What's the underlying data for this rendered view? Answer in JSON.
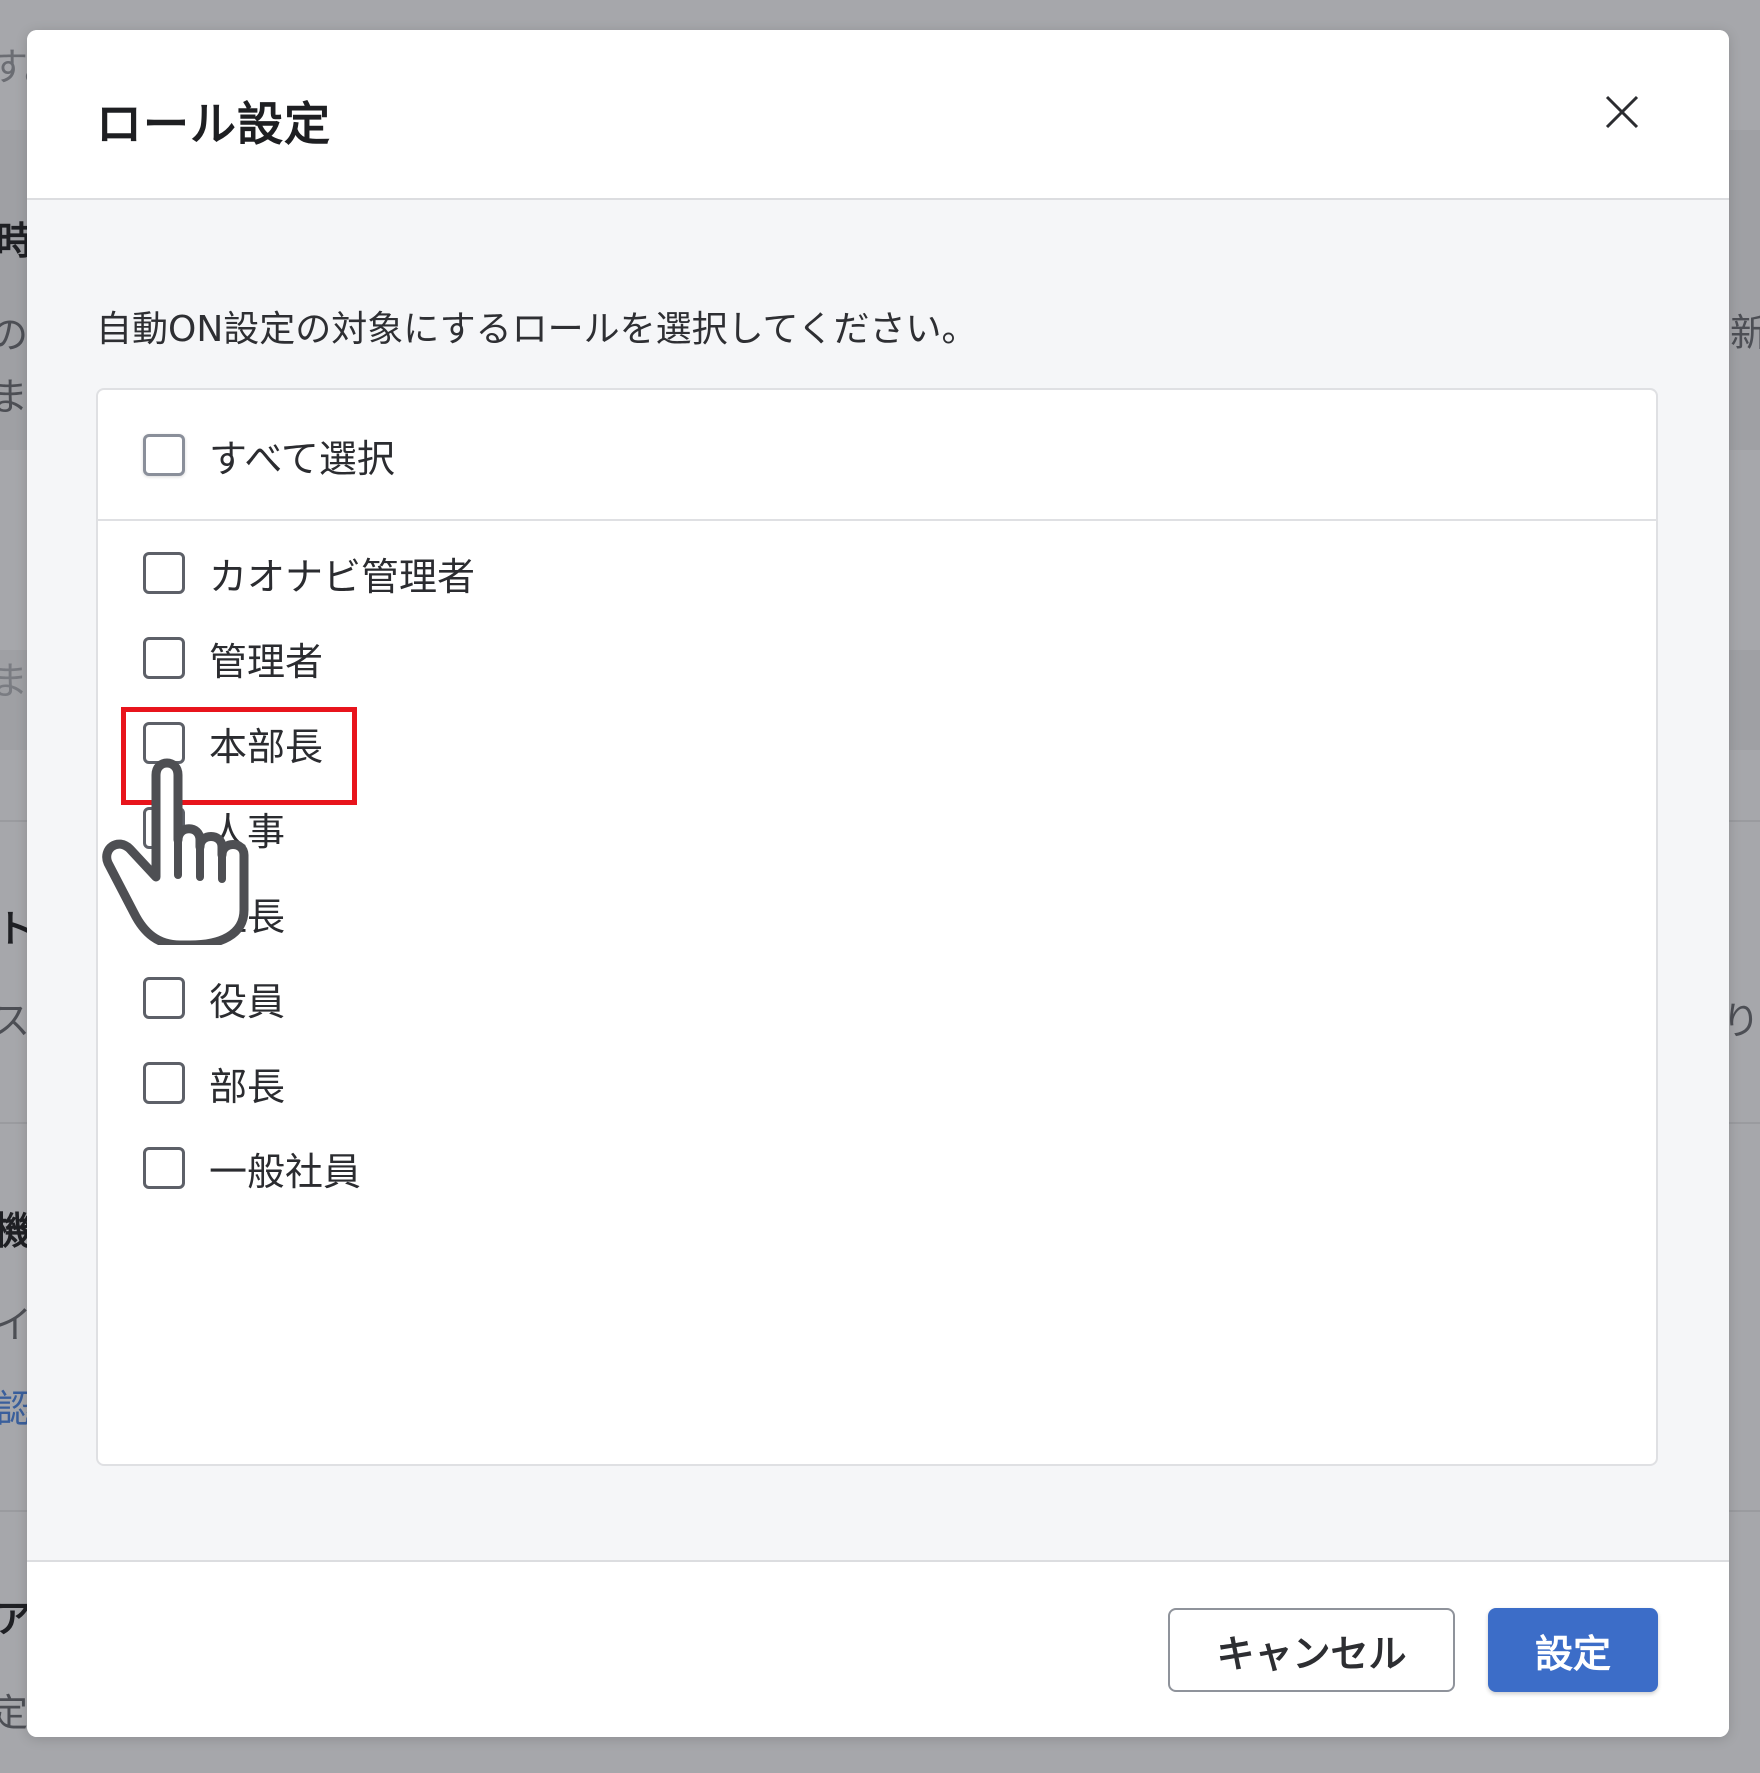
{
  "background": {
    "fragments": [
      "す。",
      "時",
      "の",
      "ま",
      "ま",
      "ト",
      "ス",
      "機",
      "イ",
      "認",
      "ア",
      "定",
      "新",
      "り"
    ]
  },
  "dialog": {
    "title": "ロール設定",
    "close_icon": "close-icon",
    "description": "自動ON設定の対象にするロールを選択してください。",
    "select_all_label": "すべて選択",
    "roles": [
      {
        "label": "カオナビ管理者",
        "checked": false
      },
      {
        "label": "管理者",
        "checked": false
      },
      {
        "label": "本部長",
        "checked": false
      },
      {
        "label": "人事",
        "checked": false
      },
      {
        "label": "社長",
        "checked": false
      },
      {
        "label": "役員",
        "checked": false
      },
      {
        "label": "部長",
        "checked": false
      },
      {
        "label": "一般社員",
        "checked": false
      }
    ],
    "cancel_label": "キャンセル",
    "submit_label": "設定"
  },
  "annotation": {
    "highlight_color": "#e8141c",
    "cursor_icon": "hand-pointer-icon"
  },
  "colors": {
    "primary": "#3c6dc8",
    "overlay": "#a6a7ab"
  }
}
